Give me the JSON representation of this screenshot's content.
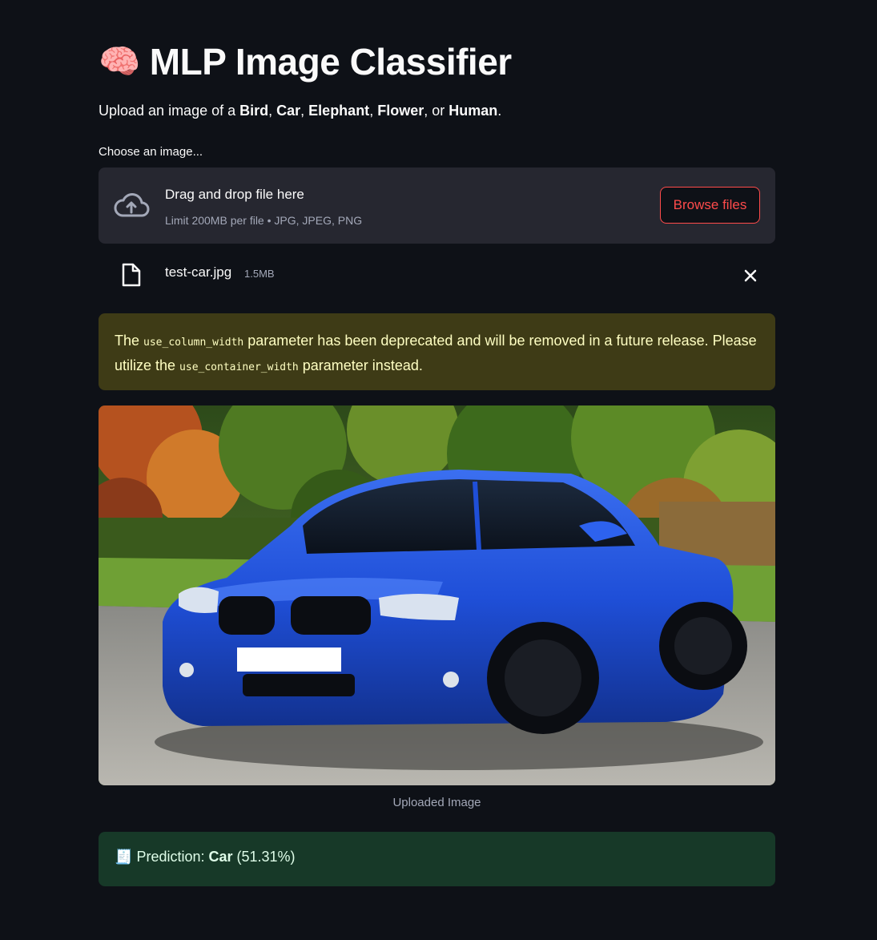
{
  "header": {
    "title_icon": "brain-emoji",
    "title": "MLP Image Classifier"
  },
  "intro": {
    "prefix": "Upload an image of a ",
    "classes": [
      "Bird",
      "Car",
      "Elephant",
      "Flower",
      "Human"
    ],
    "sep1": ", ",
    "sep2": ", ",
    "sep3": ", ",
    "sep4": ", or ",
    "suffix": "."
  },
  "uploader": {
    "label": "Choose an image...",
    "drop_text": "Drag and drop file here",
    "limit_text": "Limit 200MB per file • JPG, JPEG, PNG",
    "browse_label": "Browse files"
  },
  "uploaded_file": {
    "name": "test-car.jpg",
    "size": "1.5MB"
  },
  "warning": {
    "part1": "The ",
    "code1": "use_column_width",
    "part2": " parameter has been deprecated and will be removed in a future release. Please utilize the ",
    "code2": "use_container_width",
    "part3": " parameter instead."
  },
  "image": {
    "caption": "Uploaded Image",
    "subject": "blue car parked on road with trees in background"
  },
  "prediction": {
    "icon": "receipt-emoji",
    "label": "Prediction: ",
    "class": "Car",
    "confidence": "(51.31%)"
  },
  "colors": {
    "background": "#0e1117",
    "accent": "#ff4b4b",
    "warning_bg": "#3e3b16",
    "success_bg": "#173928",
    "car_blue": "#1f4fd8"
  }
}
